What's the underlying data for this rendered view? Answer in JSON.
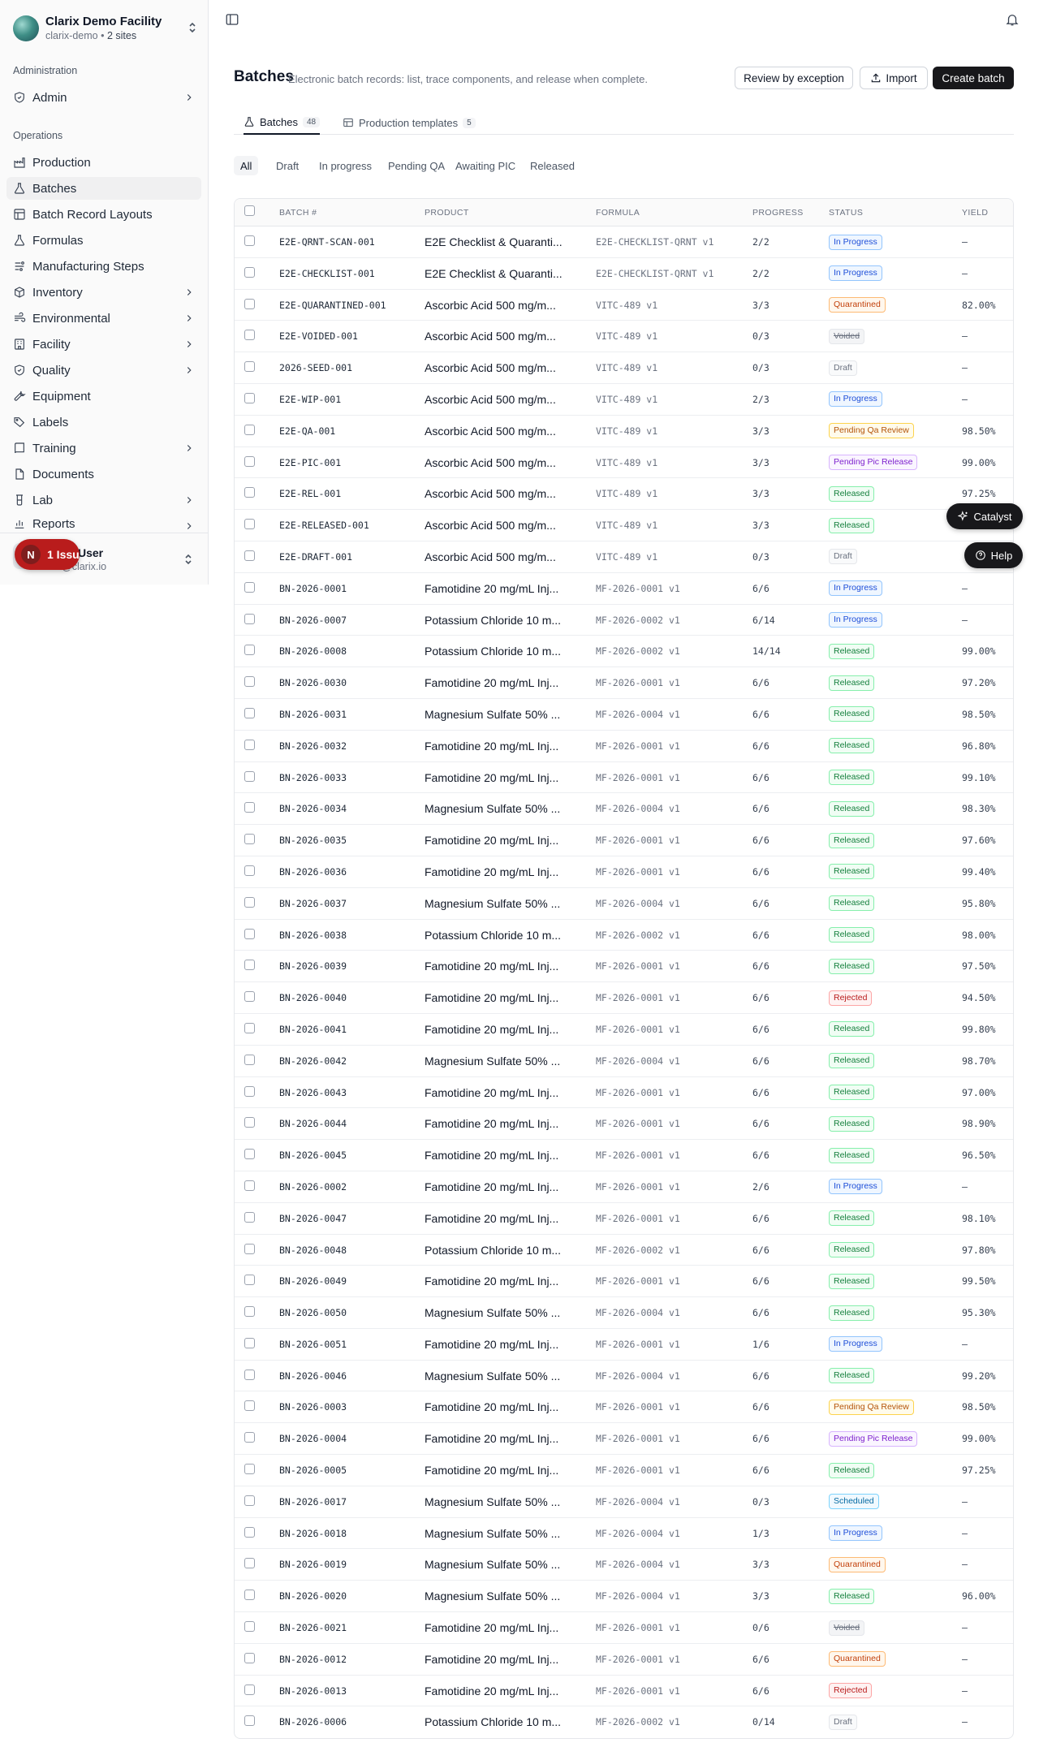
{
  "org": {
    "name": "Clarix Demo Facility",
    "slug": "clarix-demo",
    "sites": "2 sites",
    "separator": "•"
  },
  "sidebar": {
    "admin_label": "Administration",
    "admin_items": [
      {
        "label": "Admin",
        "icon": "shield-check-icon"
      }
    ],
    "ops_label": "Operations",
    "ops_items": [
      {
        "label": "Production",
        "icon": "factory-icon"
      },
      {
        "label": "Batches",
        "icon": "flask-icon"
      },
      {
        "label": "Batch Record Layouts",
        "icon": "layout-icon"
      },
      {
        "label": "Formulas",
        "icon": "flask-icon"
      },
      {
        "label": "Manufacturing Steps",
        "icon": "list-steps-icon"
      },
      {
        "label": "Inventory",
        "icon": "box-icon"
      },
      {
        "label": "Environmental",
        "icon": "wind-icon"
      },
      {
        "label": "Facility",
        "icon": "building-icon"
      },
      {
        "label": "Quality",
        "icon": "shield-check-icon"
      },
      {
        "label": "Equipment",
        "icon": "wrench-icon"
      },
      {
        "label": "Labels",
        "icon": "tag-icon"
      },
      {
        "label": "Training",
        "icon": "book-icon"
      },
      {
        "label": "Documents",
        "icon": "file-icon"
      },
      {
        "label": "Lab",
        "icon": "beaker-icon"
      },
      {
        "label": "Reports",
        "icon": "chart-icon"
      }
    ]
  },
  "user": {
    "name": "User",
    "email": "@clarix.io"
  },
  "issues": {
    "count_letter": "N",
    "label": "1 Issu"
  },
  "page": {
    "title": "Batches",
    "description": "Electronic batch records: list, trace components, and release when complete.",
    "review_button": "Review by exception",
    "import_button": "Import",
    "create_button": "Create batch"
  },
  "tabs": [
    {
      "label": "Batches",
      "count": "48"
    },
    {
      "label": "Production templates",
      "count": "5"
    }
  ],
  "filters": [
    "All",
    "Draft",
    "In progress",
    "Pending QA",
    "Awaiting PIC",
    "Released"
  ],
  "table": {
    "headers": {
      "batch": "BATCH #",
      "product": "PRODUCT",
      "formula": "FORMULA",
      "progress": "PROGRESS",
      "status": "STATUS",
      "yield": "YIELD"
    },
    "rows": [
      {
        "batch": "E2E-QRNT-SCAN-001",
        "product": "E2E Checklist & Quaranti...",
        "formula": "E2E-CHECKLIST-QRNT v1",
        "progress": "2/2",
        "status": "In Progress",
        "yield": "—"
      },
      {
        "batch": "E2E-CHECKLIST-001",
        "product": "E2E Checklist & Quaranti...",
        "formula": "E2E-CHECKLIST-QRNT v1",
        "progress": "2/2",
        "status": "In Progress",
        "yield": "—"
      },
      {
        "batch": "E2E-QUARANTINED-001",
        "product": "Ascorbic Acid 500 mg/m...",
        "formula": "VITC-489 v1",
        "progress": "3/3",
        "status": "Quarantined",
        "yield": "82.00%"
      },
      {
        "batch": "E2E-VOIDED-001",
        "product": "Ascorbic Acid 500 mg/m...",
        "formula": "VITC-489 v1",
        "progress": "0/3",
        "status": "Voided",
        "yield": "—"
      },
      {
        "batch": "2026-SEED-001",
        "product": "Ascorbic Acid 500 mg/m...",
        "formula": "VITC-489 v1",
        "progress": "0/3",
        "status": "Draft",
        "yield": "—"
      },
      {
        "batch": "E2E-WIP-001",
        "product": "Ascorbic Acid 500 mg/m...",
        "formula": "VITC-489 v1",
        "progress": "2/3",
        "status": "In Progress",
        "yield": "—"
      },
      {
        "batch": "E2E-QA-001",
        "product": "Ascorbic Acid 500 mg/m...",
        "formula": "VITC-489 v1",
        "progress": "3/3",
        "status": "Pending Qa Review",
        "yield": "98.50%"
      },
      {
        "batch": "E2E-PIC-001",
        "product": "Ascorbic Acid 500 mg/m...",
        "formula": "VITC-489 v1",
        "progress": "3/3",
        "status": "Pending Pic Release",
        "yield": "99.00%"
      },
      {
        "batch": "E2E-REL-001",
        "product": "Ascorbic Acid 500 mg/m...",
        "formula": "VITC-489 v1",
        "progress": "3/3",
        "status": "Released",
        "yield": "97.25%"
      },
      {
        "batch": "E2E-RELEASED-001",
        "product": "Ascorbic Acid 500 mg/m...",
        "formula": "VITC-489 v1",
        "progress": "3/3",
        "status": "Released",
        "yield": ""
      },
      {
        "batch": "E2E-DRAFT-001",
        "product": "Ascorbic Acid 500 mg/m...",
        "formula": "VITC-489 v1",
        "progress": "0/3",
        "status": "Draft",
        "yield": ""
      },
      {
        "batch": "BN-2026-0001",
        "product": "Famotidine 20 mg/mL Inj...",
        "formula": "MF-2026-0001 v1",
        "progress": "6/6",
        "status": "In Progress",
        "yield": "—"
      },
      {
        "batch": "BN-2026-0007",
        "product": "Potassium Chloride 10 m...",
        "formula": "MF-2026-0002 v1",
        "progress": "6/14",
        "status": "In Progress",
        "yield": "—"
      },
      {
        "batch": "BN-2026-0008",
        "product": "Potassium Chloride 10 m...",
        "formula": "MF-2026-0002 v1",
        "progress": "14/14",
        "status": "Released",
        "yield": "99.00%"
      },
      {
        "batch": "BN-2026-0030",
        "product": "Famotidine 20 mg/mL Inj...",
        "formula": "MF-2026-0001 v1",
        "progress": "6/6",
        "status": "Released",
        "yield": "97.20%"
      },
      {
        "batch": "BN-2026-0031",
        "product": "Magnesium Sulfate 50% ...",
        "formula": "MF-2026-0004 v1",
        "progress": "6/6",
        "status": "Released",
        "yield": "98.50%"
      },
      {
        "batch": "BN-2026-0032",
        "product": "Famotidine 20 mg/mL Inj...",
        "formula": "MF-2026-0001 v1",
        "progress": "6/6",
        "status": "Released",
        "yield": "96.80%"
      },
      {
        "batch": "BN-2026-0033",
        "product": "Famotidine 20 mg/mL Inj...",
        "formula": "MF-2026-0001 v1",
        "progress": "6/6",
        "status": "Released",
        "yield": "99.10%"
      },
      {
        "batch": "BN-2026-0034",
        "product": "Magnesium Sulfate 50% ...",
        "formula": "MF-2026-0004 v1",
        "progress": "6/6",
        "status": "Released",
        "yield": "98.30%"
      },
      {
        "batch": "BN-2026-0035",
        "product": "Famotidine 20 mg/mL Inj...",
        "formula": "MF-2026-0001 v1",
        "progress": "6/6",
        "status": "Released",
        "yield": "97.60%"
      },
      {
        "batch": "BN-2026-0036",
        "product": "Famotidine 20 mg/mL Inj...",
        "formula": "MF-2026-0001 v1",
        "progress": "6/6",
        "status": "Released",
        "yield": "99.40%"
      },
      {
        "batch": "BN-2026-0037",
        "product": "Magnesium Sulfate 50% ...",
        "formula": "MF-2026-0004 v1",
        "progress": "6/6",
        "status": "Released",
        "yield": "95.80%"
      },
      {
        "batch": "BN-2026-0038",
        "product": "Potassium Chloride 10 m...",
        "formula": "MF-2026-0002 v1",
        "progress": "6/6",
        "status": "Released",
        "yield": "98.00%"
      },
      {
        "batch": "BN-2026-0039",
        "product": "Famotidine 20 mg/mL Inj...",
        "formula": "MF-2026-0001 v1",
        "progress": "6/6",
        "status": "Released",
        "yield": "97.50%"
      },
      {
        "batch": "BN-2026-0040",
        "product": "Famotidine 20 mg/mL Inj...",
        "formula": "MF-2026-0001 v1",
        "progress": "6/6",
        "status": "Rejected",
        "yield": "94.50%"
      },
      {
        "batch": "BN-2026-0041",
        "product": "Famotidine 20 mg/mL Inj...",
        "formula": "MF-2026-0001 v1",
        "progress": "6/6",
        "status": "Released",
        "yield": "99.80%"
      },
      {
        "batch": "BN-2026-0042",
        "product": "Magnesium Sulfate 50% ...",
        "formula": "MF-2026-0004 v1",
        "progress": "6/6",
        "status": "Released",
        "yield": "98.70%"
      },
      {
        "batch": "BN-2026-0043",
        "product": "Famotidine 20 mg/mL Inj...",
        "formula": "MF-2026-0001 v1",
        "progress": "6/6",
        "status": "Released",
        "yield": "97.00%"
      },
      {
        "batch": "BN-2026-0044",
        "product": "Famotidine 20 mg/mL Inj...",
        "formula": "MF-2026-0001 v1",
        "progress": "6/6",
        "status": "Released",
        "yield": "98.90%"
      },
      {
        "batch": "BN-2026-0045",
        "product": "Famotidine 20 mg/mL Inj...",
        "formula": "MF-2026-0001 v1",
        "progress": "6/6",
        "status": "Released",
        "yield": "96.50%"
      },
      {
        "batch": "BN-2026-0002",
        "product": "Famotidine 20 mg/mL Inj...",
        "formula": "MF-2026-0001 v1",
        "progress": "2/6",
        "status": "In Progress",
        "yield": "—"
      },
      {
        "batch": "BN-2026-0047",
        "product": "Famotidine 20 mg/mL Inj...",
        "formula": "MF-2026-0001 v1",
        "progress": "6/6",
        "status": "Released",
        "yield": "98.10%"
      },
      {
        "batch": "BN-2026-0048",
        "product": "Potassium Chloride 10 m...",
        "formula": "MF-2026-0002 v1",
        "progress": "6/6",
        "status": "Released",
        "yield": "97.80%"
      },
      {
        "batch": "BN-2026-0049",
        "product": "Famotidine 20 mg/mL Inj...",
        "formula": "MF-2026-0001 v1",
        "progress": "6/6",
        "status": "Released",
        "yield": "99.50%"
      },
      {
        "batch": "BN-2026-0050",
        "product": "Magnesium Sulfate 50% ...",
        "formula": "MF-2026-0004 v1",
        "progress": "6/6",
        "status": "Released",
        "yield": "95.30%"
      },
      {
        "batch": "BN-2026-0051",
        "product": "Famotidine 20 mg/mL Inj...",
        "formula": "MF-2026-0001 v1",
        "progress": "1/6",
        "status": "In Progress",
        "yield": "—"
      },
      {
        "batch": "BN-2026-0046",
        "product": "Magnesium Sulfate 50% ...",
        "formula": "MF-2026-0004 v1",
        "progress": "6/6",
        "status": "Released",
        "yield": "99.20%"
      },
      {
        "batch": "BN-2026-0003",
        "product": "Famotidine 20 mg/mL Inj...",
        "formula": "MF-2026-0001 v1",
        "progress": "6/6",
        "status": "Pending Qa Review",
        "yield": "98.50%"
      },
      {
        "batch": "BN-2026-0004",
        "product": "Famotidine 20 mg/mL Inj...",
        "formula": "MF-2026-0001 v1",
        "progress": "6/6",
        "status": "Pending Pic Release",
        "yield": "99.00%"
      },
      {
        "batch": "BN-2026-0005",
        "product": "Famotidine 20 mg/mL Inj...",
        "formula": "MF-2026-0001 v1",
        "progress": "6/6",
        "status": "Released",
        "yield": "97.25%"
      },
      {
        "batch": "BN-2026-0017",
        "product": "Magnesium Sulfate 50% ...",
        "formula": "MF-2026-0004 v1",
        "progress": "0/3",
        "status": "Scheduled",
        "yield": "—"
      },
      {
        "batch": "BN-2026-0018",
        "product": "Magnesium Sulfate 50% ...",
        "formula": "MF-2026-0004 v1",
        "progress": "1/3",
        "status": "In Progress",
        "yield": "—"
      },
      {
        "batch": "BN-2026-0019",
        "product": "Magnesium Sulfate 50% ...",
        "formula": "MF-2026-0004 v1",
        "progress": "3/3",
        "status": "Quarantined",
        "yield": "—"
      },
      {
        "batch": "BN-2026-0020",
        "product": "Magnesium Sulfate 50% ...",
        "formula": "MF-2026-0004 v1",
        "progress": "3/3",
        "status": "Released",
        "yield": "96.00%"
      },
      {
        "batch": "BN-2026-0021",
        "product": "Famotidine 20 mg/mL Inj...",
        "formula": "MF-2026-0001 v1",
        "progress": "0/6",
        "status": "Voided",
        "yield": "—"
      },
      {
        "batch": "BN-2026-0012",
        "product": "Famotidine 20 mg/mL Inj...",
        "formula": "MF-2026-0001 v1",
        "progress": "6/6",
        "status": "Quarantined",
        "yield": "—"
      },
      {
        "batch": "BN-2026-0013",
        "product": "Famotidine 20 mg/mL Inj...",
        "formula": "MF-2026-0001 v1",
        "progress": "6/6",
        "status": "Rejected",
        "yield": "—"
      },
      {
        "batch": "BN-2026-0006",
        "product": "Potassium Chloride 10 m...",
        "formula": "MF-2026-0002 v1",
        "progress": "0/14",
        "status": "Draft",
        "yield": "—"
      }
    ]
  },
  "floating": {
    "catalyst": "Catalyst",
    "help": "Help"
  }
}
